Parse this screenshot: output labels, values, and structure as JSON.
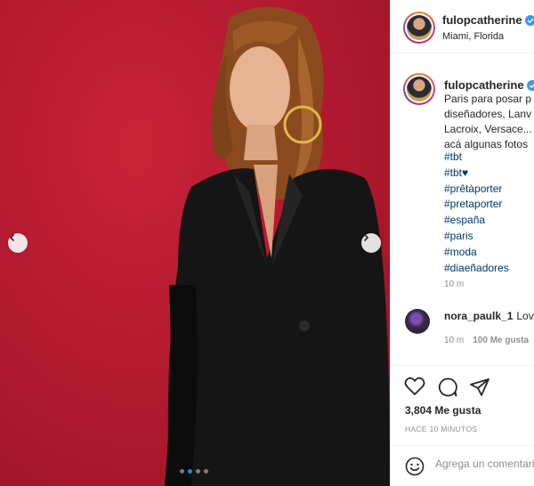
{
  "photo": {
    "alt_icon": "image",
    "prev_icon": "chevron-left-icon",
    "next_icon": "chevron-right-icon",
    "slide_count": 4,
    "active_slide": 2
  },
  "header": {
    "username": "fulopcatherine",
    "verified_icon": "verified-badge-icon",
    "location": "Miami, Florida"
  },
  "caption": {
    "username": "fulopcatherine",
    "lines": [
      "Paris para posar p",
      "diseñadores, Lanv",
      "Lacroix, Versace...",
      "acá algunas fotos"
    ],
    "hashtags": [
      "#tbt",
      "#tbt♥",
      "#prêtàporter",
      "#pretaporter",
      "#españa",
      "#paris",
      "#moda",
      "#diaeñadores"
    ],
    "time": "10 m"
  },
  "comment": {
    "username": "nora_paulk_1",
    "text": "Love",
    "time": "10 m",
    "likes": "100 Me gusta"
  },
  "actions": {
    "likes": "3,804 Me gusta",
    "posted": "HACE 10 MINUTOS"
  },
  "add_comment": {
    "placeholder": "Agrega un comentario"
  },
  "colors": {
    "link": "#00376b",
    "verified": "#3897f0",
    "background_red": "#b41a30"
  }
}
